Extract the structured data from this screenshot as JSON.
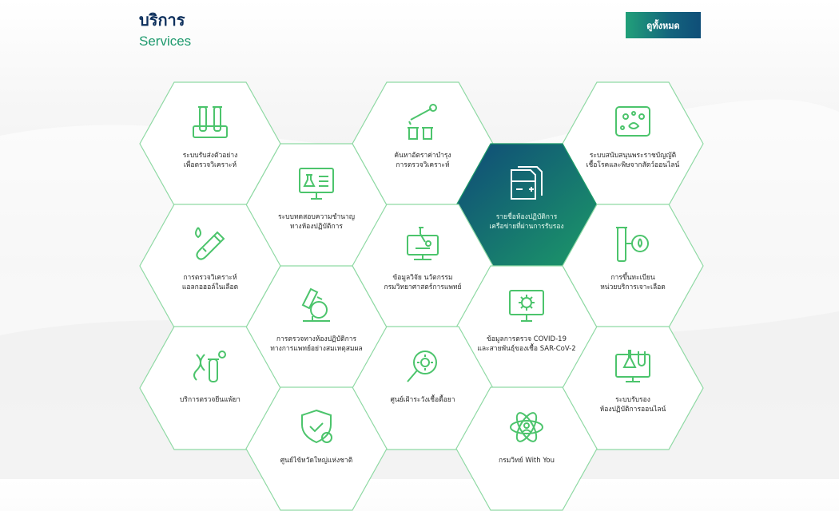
{
  "header": {
    "title_th": "บริการ",
    "title_en": "Services",
    "view_all_label": "ดูทั้งหมด"
  },
  "colors": {
    "accent_green": "#4cc46c",
    "brand_navy": "#0d2f5c",
    "active_from": "#0f4a78",
    "active_to": "#1c9a68"
  },
  "services": [
    {
      "id": "sample-shipping",
      "icon": "test-tubes-rack-icon",
      "line1": "ระบบรับส่งตัวอย่าง",
      "line2": "เพื่อตรวจวิเคราะห์",
      "active": false
    },
    {
      "id": "analysis-fee",
      "icon": "dropper-tubes-icon",
      "line1": "ค้นหาอัตราค่าบำรุง",
      "line2": "การตรวจวิเคราะห์",
      "active": false
    },
    {
      "id": "pathogen-registry",
      "icon": "petri-dish-icon",
      "line1": "ระบบสนับสนุนพระราชบัญญัติ",
      "line2": "เชื้อโรคและพิษจากสัตว์ออนไลน์",
      "active": false
    },
    {
      "id": "proficiency-test",
      "icon": "lab-monitor-icon",
      "line1": "ระบบทดสอบความชำนาญ",
      "line2": "ทางห้องปฏิบัติการ",
      "active": false
    },
    {
      "id": "lab-network",
      "icon": "document-plus-icon",
      "line1": "รายชื่อห้องปฏิบัติการ",
      "line2": "เครือข่ายที่ผ่านการรับรอง",
      "active": true
    },
    {
      "id": "blood-alcohol",
      "icon": "blood-tube-icon",
      "line1": "การตรวจวิเคราะห์",
      "line2": "แอลกอฮอล์ในเลือด",
      "active": false
    },
    {
      "id": "research-innovation",
      "icon": "microscope-monitor-icon",
      "line1": "ข้อมูลวิจัย นวัตกรรม",
      "line2": "กรมวิทยาศาสตร์การแพทย์",
      "active": false
    },
    {
      "id": "blood-collection",
      "icon": "blood-drop-tube-icon",
      "line1": "การขึ้นทะเบียน",
      "line2": "หน่วยบริการเจาะเลือด",
      "active": false
    },
    {
      "id": "forensic-lab",
      "icon": "microscope-icon",
      "line1": "การตรวจทางห้องปฏิบัติการ",
      "line2": "ทางการแพทย์อย่างสมเหตุสมผล",
      "active": false
    },
    {
      "id": "covid-data",
      "icon": "virus-monitor-icon",
      "line1": "ข้อมูลการตรวจ COVID-19",
      "line2": "และสายพันธุ์ของเชื้อ SAR-CoV-2",
      "active": false
    },
    {
      "id": "genetic-test",
      "icon": "dna-tube-icon",
      "line1": "บริการตรวจยีนแพ้ยา",
      "line2": "",
      "active": false
    },
    {
      "id": "drug-resistance",
      "icon": "virus-magnifier-icon",
      "line1": "ศูนย์เฝ้าระวังเชื้อดื้อยา",
      "line2": "",
      "active": false
    },
    {
      "id": "lab-certification",
      "icon": "lab-flask-screen-icon",
      "line1": "ระบบรับรอง",
      "line2": "ห้องปฏิบัติการออนไลน์",
      "active": false
    },
    {
      "id": "national-flu",
      "icon": "shield-check-icon",
      "line1": "ศูนย์ไข้หวัดใหญ่แห่งชาติ",
      "line2": "",
      "active": false
    },
    {
      "id": "dmsc-with-you",
      "icon": "atom-person-icon",
      "line1": "กรมวิทย์ With You",
      "line2": "",
      "active": false
    }
  ]
}
